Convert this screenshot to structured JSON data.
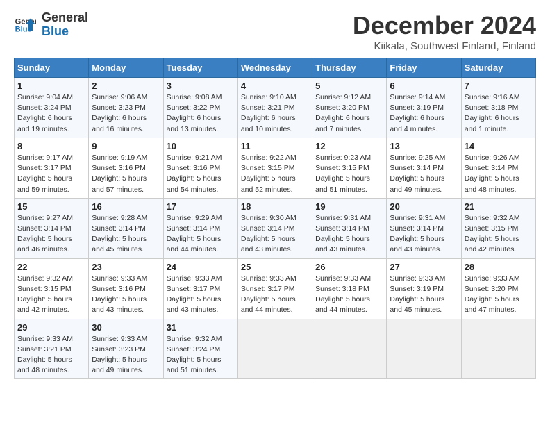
{
  "logo": {
    "line1": "General",
    "line2": "Blue"
  },
  "title": "December 2024",
  "subtitle": "Kiikala, Southwest Finland, Finland",
  "weekdays": [
    "Sunday",
    "Monday",
    "Tuesday",
    "Wednesday",
    "Thursday",
    "Friday",
    "Saturday"
  ],
  "weeks": [
    [
      {
        "day": "1",
        "info": "Sunrise: 9:04 AM\nSunset: 3:24 PM\nDaylight: 6 hours\nand 19 minutes."
      },
      {
        "day": "2",
        "info": "Sunrise: 9:06 AM\nSunset: 3:23 PM\nDaylight: 6 hours\nand 16 minutes."
      },
      {
        "day": "3",
        "info": "Sunrise: 9:08 AM\nSunset: 3:22 PM\nDaylight: 6 hours\nand 13 minutes."
      },
      {
        "day": "4",
        "info": "Sunrise: 9:10 AM\nSunset: 3:21 PM\nDaylight: 6 hours\nand 10 minutes."
      },
      {
        "day": "5",
        "info": "Sunrise: 9:12 AM\nSunset: 3:20 PM\nDaylight: 6 hours\nand 7 minutes."
      },
      {
        "day": "6",
        "info": "Sunrise: 9:14 AM\nSunset: 3:19 PM\nDaylight: 6 hours\nand 4 minutes."
      },
      {
        "day": "7",
        "info": "Sunrise: 9:16 AM\nSunset: 3:18 PM\nDaylight: 6 hours\nand 1 minute."
      }
    ],
    [
      {
        "day": "8",
        "info": "Sunrise: 9:17 AM\nSunset: 3:17 PM\nDaylight: 5 hours\nand 59 minutes."
      },
      {
        "day": "9",
        "info": "Sunrise: 9:19 AM\nSunset: 3:16 PM\nDaylight: 5 hours\nand 57 minutes."
      },
      {
        "day": "10",
        "info": "Sunrise: 9:21 AM\nSunset: 3:16 PM\nDaylight: 5 hours\nand 54 minutes."
      },
      {
        "day": "11",
        "info": "Sunrise: 9:22 AM\nSunset: 3:15 PM\nDaylight: 5 hours\nand 52 minutes."
      },
      {
        "day": "12",
        "info": "Sunrise: 9:23 AM\nSunset: 3:15 PM\nDaylight: 5 hours\nand 51 minutes."
      },
      {
        "day": "13",
        "info": "Sunrise: 9:25 AM\nSunset: 3:14 PM\nDaylight: 5 hours\nand 49 minutes."
      },
      {
        "day": "14",
        "info": "Sunrise: 9:26 AM\nSunset: 3:14 PM\nDaylight: 5 hours\nand 48 minutes."
      }
    ],
    [
      {
        "day": "15",
        "info": "Sunrise: 9:27 AM\nSunset: 3:14 PM\nDaylight: 5 hours\nand 46 minutes."
      },
      {
        "day": "16",
        "info": "Sunrise: 9:28 AM\nSunset: 3:14 PM\nDaylight: 5 hours\nand 45 minutes."
      },
      {
        "day": "17",
        "info": "Sunrise: 9:29 AM\nSunset: 3:14 PM\nDaylight: 5 hours\nand 44 minutes."
      },
      {
        "day": "18",
        "info": "Sunrise: 9:30 AM\nSunset: 3:14 PM\nDaylight: 5 hours\nand 43 minutes."
      },
      {
        "day": "19",
        "info": "Sunrise: 9:31 AM\nSunset: 3:14 PM\nDaylight: 5 hours\nand 43 minutes."
      },
      {
        "day": "20",
        "info": "Sunrise: 9:31 AM\nSunset: 3:14 PM\nDaylight: 5 hours\nand 43 minutes."
      },
      {
        "day": "21",
        "info": "Sunrise: 9:32 AM\nSunset: 3:15 PM\nDaylight: 5 hours\nand 42 minutes."
      }
    ],
    [
      {
        "day": "22",
        "info": "Sunrise: 9:32 AM\nSunset: 3:15 PM\nDaylight: 5 hours\nand 42 minutes."
      },
      {
        "day": "23",
        "info": "Sunrise: 9:33 AM\nSunset: 3:16 PM\nDaylight: 5 hours\nand 43 minutes."
      },
      {
        "day": "24",
        "info": "Sunrise: 9:33 AM\nSunset: 3:17 PM\nDaylight: 5 hours\nand 43 minutes."
      },
      {
        "day": "25",
        "info": "Sunrise: 9:33 AM\nSunset: 3:17 PM\nDaylight: 5 hours\nand 44 minutes."
      },
      {
        "day": "26",
        "info": "Sunrise: 9:33 AM\nSunset: 3:18 PM\nDaylight: 5 hours\nand 44 minutes."
      },
      {
        "day": "27",
        "info": "Sunrise: 9:33 AM\nSunset: 3:19 PM\nDaylight: 5 hours\nand 45 minutes."
      },
      {
        "day": "28",
        "info": "Sunrise: 9:33 AM\nSunset: 3:20 PM\nDaylight: 5 hours\nand 47 minutes."
      }
    ],
    [
      {
        "day": "29",
        "info": "Sunrise: 9:33 AM\nSunset: 3:21 PM\nDaylight: 5 hours\nand 48 minutes."
      },
      {
        "day": "30",
        "info": "Sunrise: 9:33 AM\nSunset: 3:23 PM\nDaylight: 5 hours\nand 49 minutes."
      },
      {
        "day": "31",
        "info": "Sunrise: 9:32 AM\nSunset: 3:24 PM\nDaylight: 5 hours\nand 51 minutes."
      },
      null,
      null,
      null,
      null
    ]
  ]
}
